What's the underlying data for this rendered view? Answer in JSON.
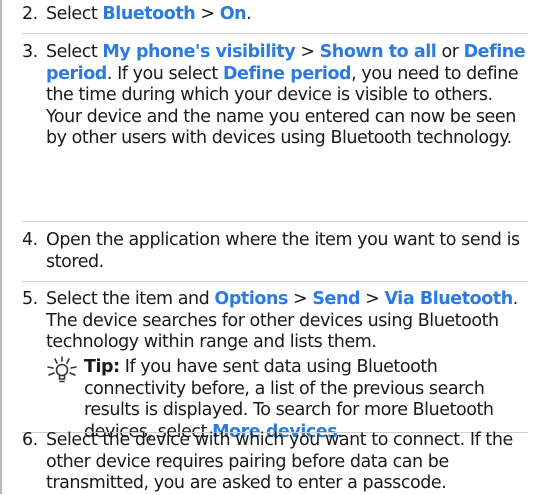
{
  "colors": {
    "keyword": "#2c7be0",
    "text": "#1a1a1a",
    "separator": "#cfcfcf"
  },
  "steps": [
    {
      "num": "2.",
      "parts": [
        "Select ",
        "Bluetooth",
        " > ",
        "On",
        "."
      ]
    },
    {
      "num": "3.",
      "parts": [
        "Select ",
        "My phone's visibility",
        " > ",
        "Shown to all",
        " or ",
        "Define period",
        ". If you select ",
        "Define period",
        ", you need to define the time during which your device is visible to others. Your device and the name you entered can now be seen by other users with devices using Bluetooth technology."
      ]
    },
    {
      "num": "4.",
      "text": "Open the application where the item you want to send is stored."
    },
    {
      "num": "5.",
      "parts": [
        "Select the item and ",
        "Options",
        " > ",
        "Send",
        " > ",
        "Via Bluetooth",
        ". The device searches for other devices using Bluetooth technology within range and lists them."
      ]
    },
    {
      "num": "6.",
      "text": "Select the device with which you want to connect. If the other device requires pairing before data can be transmitted, you are asked to enter a passcode."
    }
  ],
  "tip": {
    "icon": "lightbulb-icon",
    "label": "Tip:",
    "parts": [
      " If you have sent data using Bluetooth connectivity before, a list of the previous search results is displayed. To search for more Bluetooth devices, select ",
      "More devices",
      "."
    ]
  }
}
